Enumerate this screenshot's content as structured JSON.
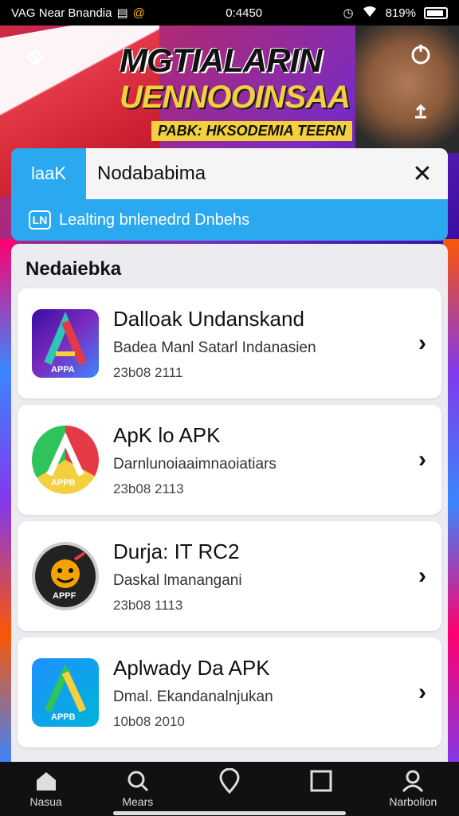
{
  "status_bar": {
    "left_text": "VAG Near Bnandia",
    "time": "0:4450",
    "battery": "819%"
  },
  "banner": {
    "title": "MGTIALARIN",
    "subtitle": "UENNOOINSAA",
    "tagline": "PABK: HKSODEMIA TEERN"
  },
  "search": {
    "scope_label": "laaK",
    "value": "Nodababima",
    "hint": "Lealting bnlenedrd Dnbehs"
  },
  "results": {
    "section_title": "Nedaiebka",
    "items": [
      {
        "name": "Dalloak Undanskand",
        "desc": "Badea Manl Satarl Indanasien",
        "meta": "23b08 2111",
        "icon_label": "APPA"
      },
      {
        "name": "ApK lo APK",
        "desc": "Darnlunoiaaimnaoiatiars",
        "meta": "23b08 2113",
        "icon_label": "APPB"
      },
      {
        "name": "Durja: IT RC2",
        "desc": "Daskal lmanangani",
        "meta": "23b08 1113",
        "icon_label": "APPF"
      },
      {
        "name": "Aplwady Da APK",
        "desc": "Dmal. Ekandanalnjukan",
        "meta": "10b08 2010",
        "icon_label": "APPB"
      }
    ]
  },
  "nav": {
    "items": [
      {
        "label": "Nasua"
      },
      {
        "label": "Mears"
      },
      {
        "label": ""
      },
      {
        "label": ""
      },
      {
        "label": "Narbolion"
      }
    ]
  },
  "colors": {
    "accent": "#2aa8f0",
    "nav_bg": "#111111"
  }
}
